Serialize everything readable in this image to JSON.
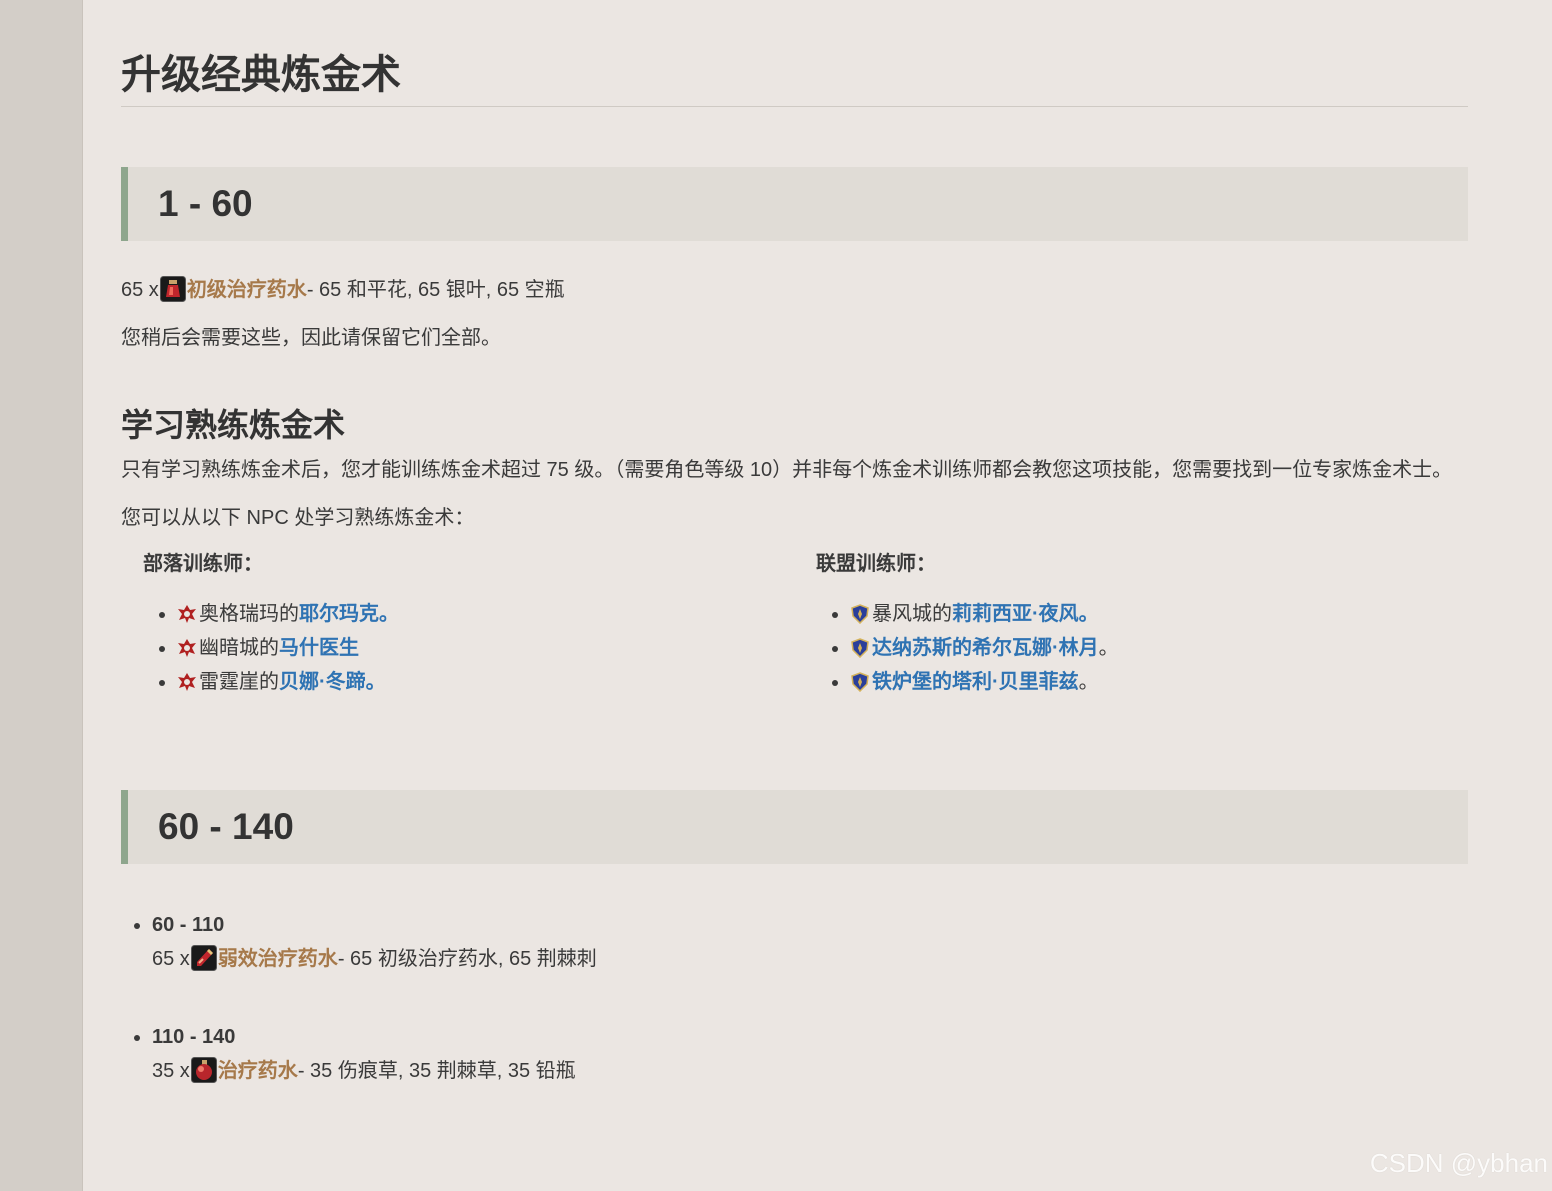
{
  "page": {
    "title": "升级经典炼金术"
  },
  "section1": {
    "heading": "1 - 60",
    "recipe": {
      "qty_prefix": "65 x",
      "item_name": "初级治疗药水",
      "item_icon": "red-potion-icon",
      "reagents": "- 65 和平花, 65 银叶, 65 空瓶"
    },
    "note": "您稍后会需要这些，因此请保留它们全部。"
  },
  "learn": {
    "heading": "学习熟练炼金术",
    "para1": "只有学习熟练炼金术后，您才能训练炼金术超过 75 级。（需要角色等级 10）并非每个炼金术训练师都会教您这项技能，您需要找到一位专家炼金术士。",
    "para2": "您可以从以下 NPC 处学习熟练炼金术：",
    "horde": {
      "heading": "部落训练师：",
      "icon": "horde-icon",
      "icon_color": "#b02020",
      "items": [
        {
          "prefix": "奥格瑞玛的",
          "npc": "耶尔玛克。",
          "suffix": ""
        },
        {
          "prefix": "幽暗城的",
          "npc": "马什医生",
          "suffix": ""
        },
        {
          "prefix": "雷霆崖的",
          "npc": "贝娜·冬蹄。",
          "suffix": ""
        }
      ]
    },
    "alliance": {
      "heading": "联盟训练师：",
      "icon": "alliance-icon",
      "icon_color": "#2a3f9a",
      "items": [
        {
          "prefix": "暴风城的",
          "npc": "莉莉西亚·夜风。",
          "suffix": ""
        },
        {
          "prefix": "",
          "npc": "达纳苏斯的希尔瓦娜·林月",
          "suffix": "。"
        },
        {
          "prefix": "",
          "npc": "铁炉堡的塔利·贝里菲兹",
          "suffix": "。"
        }
      ]
    }
  },
  "section2": {
    "heading": "60 - 140",
    "steps": [
      {
        "range": "60 - 110",
        "qty_prefix": "65 x",
        "item_name": "弱效治疗药水",
        "item_icon": "thin-potion-icon",
        "reagents": "- 65 初级治疗药水, 65 荆棘刺"
      },
      {
        "range": "110 - 140",
        "qty_prefix": "35 x",
        "item_name": "治疗药水",
        "item_icon": "round-potion-icon",
        "reagents": "- 35 伤痕草, 35 荆棘草, 35 铅瓶"
      }
    ]
  },
  "colors": {
    "item_link": "#a6794a",
    "npc_link": "#2f73b3",
    "band_accent": "#8ea68d",
    "band_bg": "#e0dcd6",
    "page_bg": "#ebe6e2"
  },
  "watermark": "CSDN @ybhan"
}
